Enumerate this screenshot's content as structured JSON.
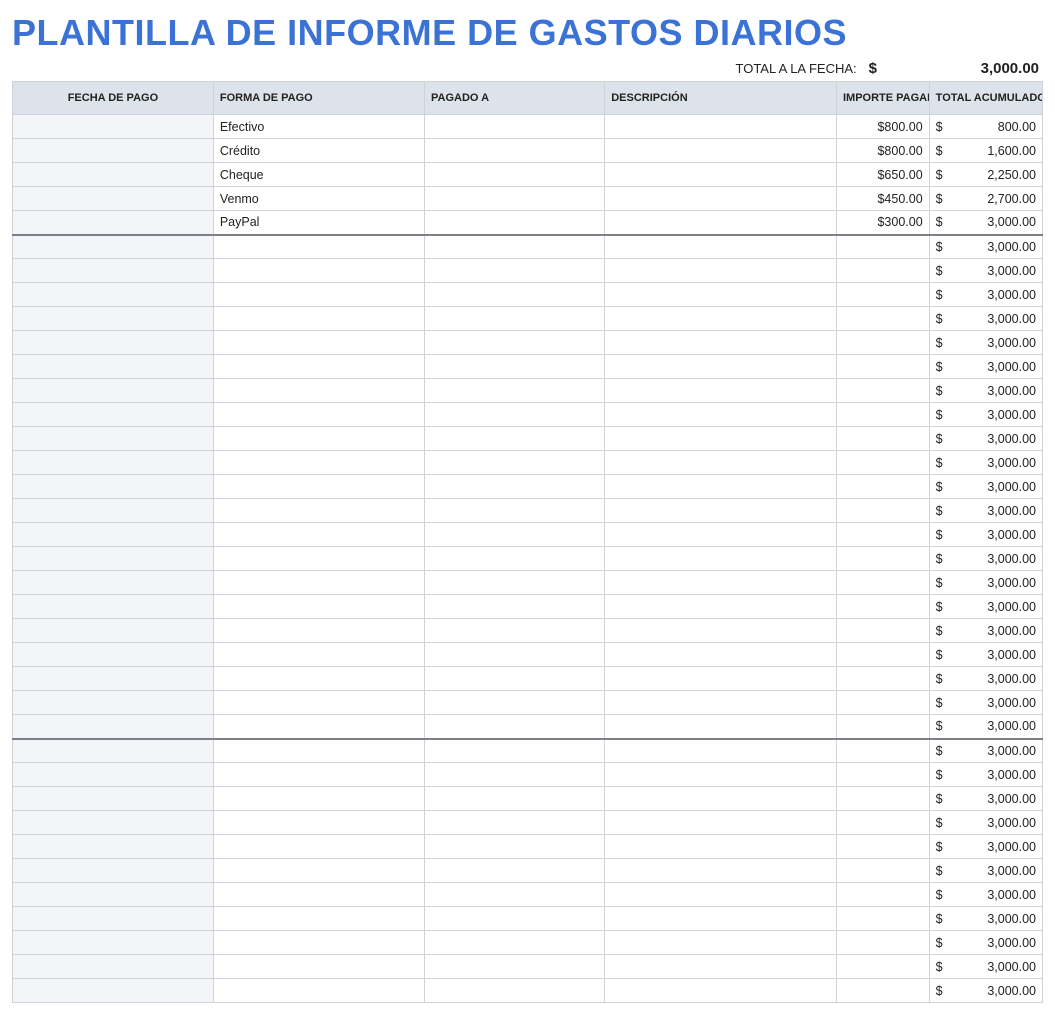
{
  "title": "PLANTILLA DE INFORME DE GASTOS DIARIOS",
  "summary": {
    "label": "TOTAL A LA FECHA:",
    "currency": "$",
    "value": "3,000.00"
  },
  "columns": {
    "fecha": "FECHA DE PAGO",
    "forma": "FORMA DE PAGO",
    "pagado_a": "PAGADO A",
    "descripcion": "DESCRIPCIÓN",
    "importe": "IMPORTE PAGADO",
    "total_acum": "TOTAL ACUMULADO"
  },
  "rows": [
    {
      "fecha": "",
      "forma": "Efectivo",
      "pagado_a": "",
      "descripcion": "",
      "importe": "$800.00",
      "acum_sign": "$",
      "acum_val": "800.00"
    },
    {
      "fecha": "",
      "forma": "Crédito",
      "pagado_a": "",
      "descripcion": "",
      "importe": "$800.00",
      "acum_sign": "$",
      "acum_val": "1,600.00"
    },
    {
      "fecha": "",
      "forma": "Cheque",
      "pagado_a": "",
      "descripcion": "",
      "importe": "$650.00",
      "acum_sign": "$",
      "acum_val": "2,250.00"
    },
    {
      "fecha": "",
      "forma": "Venmo",
      "pagado_a": "",
      "descripcion": "",
      "importe": "$450.00",
      "acum_sign": "$",
      "acum_val": "2,700.00"
    },
    {
      "fecha": "",
      "forma": "PayPal",
      "pagado_a": "",
      "descripcion": "",
      "importe": "$300.00",
      "acum_sign": "$",
      "acum_val": "3,000.00"
    },
    {
      "fecha": "",
      "forma": "",
      "pagado_a": "",
      "descripcion": "",
      "importe": "",
      "acum_sign": "$",
      "acum_val": "3,000.00",
      "sep": true
    },
    {
      "fecha": "",
      "forma": "",
      "pagado_a": "",
      "descripcion": "",
      "importe": "",
      "acum_sign": "$",
      "acum_val": "3,000.00"
    },
    {
      "fecha": "",
      "forma": "",
      "pagado_a": "",
      "descripcion": "",
      "importe": "",
      "acum_sign": "$",
      "acum_val": "3,000.00"
    },
    {
      "fecha": "",
      "forma": "",
      "pagado_a": "",
      "descripcion": "",
      "importe": "",
      "acum_sign": "$",
      "acum_val": "3,000.00"
    },
    {
      "fecha": "",
      "forma": "",
      "pagado_a": "",
      "descripcion": "",
      "importe": "",
      "acum_sign": "$",
      "acum_val": "3,000.00"
    },
    {
      "fecha": "",
      "forma": "",
      "pagado_a": "",
      "descripcion": "",
      "importe": "",
      "acum_sign": "$",
      "acum_val": "3,000.00"
    },
    {
      "fecha": "",
      "forma": "",
      "pagado_a": "",
      "descripcion": "",
      "importe": "",
      "acum_sign": "$",
      "acum_val": "3,000.00"
    },
    {
      "fecha": "",
      "forma": "",
      "pagado_a": "",
      "descripcion": "",
      "importe": "",
      "acum_sign": "$",
      "acum_val": "3,000.00"
    },
    {
      "fecha": "",
      "forma": "",
      "pagado_a": "",
      "descripcion": "",
      "importe": "",
      "acum_sign": "$",
      "acum_val": "3,000.00"
    },
    {
      "fecha": "",
      "forma": "",
      "pagado_a": "",
      "descripcion": "",
      "importe": "",
      "acum_sign": "$",
      "acum_val": "3,000.00"
    },
    {
      "fecha": "",
      "forma": "",
      "pagado_a": "",
      "descripcion": "",
      "importe": "",
      "acum_sign": "$",
      "acum_val": "3,000.00"
    },
    {
      "fecha": "",
      "forma": "",
      "pagado_a": "",
      "descripcion": "",
      "importe": "",
      "acum_sign": "$",
      "acum_val": "3,000.00"
    },
    {
      "fecha": "",
      "forma": "",
      "pagado_a": "",
      "descripcion": "",
      "importe": "",
      "acum_sign": "$",
      "acum_val": "3,000.00"
    },
    {
      "fecha": "",
      "forma": "",
      "pagado_a": "",
      "descripcion": "",
      "importe": "",
      "acum_sign": "$",
      "acum_val": "3,000.00"
    },
    {
      "fecha": "",
      "forma": "",
      "pagado_a": "",
      "descripcion": "",
      "importe": "",
      "acum_sign": "$",
      "acum_val": "3,000.00"
    },
    {
      "fecha": "",
      "forma": "",
      "pagado_a": "",
      "descripcion": "",
      "importe": "",
      "acum_sign": "$",
      "acum_val": "3,000.00"
    },
    {
      "fecha": "",
      "forma": "",
      "pagado_a": "",
      "descripcion": "",
      "importe": "",
      "acum_sign": "$",
      "acum_val": "3,000.00"
    },
    {
      "fecha": "",
      "forma": "",
      "pagado_a": "",
      "descripcion": "",
      "importe": "",
      "acum_sign": "$",
      "acum_val": "3,000.00"
    },
    {
      "fecha": "",
      "forma": "",
      "pagado_a": "",
      "descripcion": "",
      "importe": "",
      "acum_sign": "$",
      "acum_val": "3,000.00"
    },
    {
      "fecha": "",
      "forma": "",
      "pagado_a": "",
      "descripcion": "",
      "importe": "",
      "acum_sign": "$",
      "acum_val": "3,000.00"
    },
    {
      "fecha": "",
      "forma": "",
      "pagado_a": "",
      "descripcion": "",
      "importe": "",
      "acum_sign": "$",
      "acum_val": "3,000.00"
    },
    {
      "fecha": "",
      "forma": "",
      "pagado_a": "",
      "descripcion": "",
      "importe": "",
      "acum_sign": "$",
      "acum_val": "3,000.00",
      "sep": true
    },
    {
      "fecha": "",
      "forma": "",
      "pagado_a": "",
      "descripcion": "",
      "importe": "",
      "acum_sign": "$",
      "acum_val": "3,000.00"
    },
    {
      "fecha": "",
      "forma": "",
      "pagado_a": "",
      "descripcion": "",
      "importe": "",
      "acum_sign": "$",
      "acum_val": "3,000.00"
    },
    {
      "fecha": "",
      "forma": "",
      "pagado_a": "",
      "descripcion": "",
      "importe": "",
      "acum_sign": "$",
      "acum_val": "3,000.00"
    },
    {
      "fecha": "",
      "forma": "",
      "pagado_a": "",
      "descripcion": "",
      "importe": "",
      "acum_sign": "$",
      "acum_val": "3,000.00"
    },
    {
      "fecha": "",
      "forma": "",
      "pagado_a": "",
      "descripcion": "",
      "importe": "",
      "acum_sign": "$",
      "acum_val": "3,000.00"
    },
    {
      "fecha": "",
      "forma": "",
      "pagado_a": "",
      "descripcion": "",
      "importe": "",
      "acum_sign": "$",
      "acum_val": "3,000.00"
    },
    {
      "fecha": "",
      "forma": "",
      "pagado_a": "",
      "descripcion": "",
      "importe": "",
      "acum_sign": "$",
      "acum_val": "3,000.00"
    },
    {
      "fecha": "",
      "forma": "",
      "pagado_a": "",
      "descripcion": "",
      "importe": "",
      "acum_sign": "$",
      "acum_val": "3,000.00"
    },
    {
      "fecha": "",
      "forma": "",
      "pagado_a": "",
      "descripcion": "",
      "importe": "",
      "acum_sign": "$",
      "acum_val": "3,000.00"
    },
    {
      "fecha": "",
      "forma": "",
      "pagado_a": "",
      "descripcion": "",
      "importe": "",
      "acum_sign": "$",
      "acum_val": "3,000.00"
    }
  ]
}
